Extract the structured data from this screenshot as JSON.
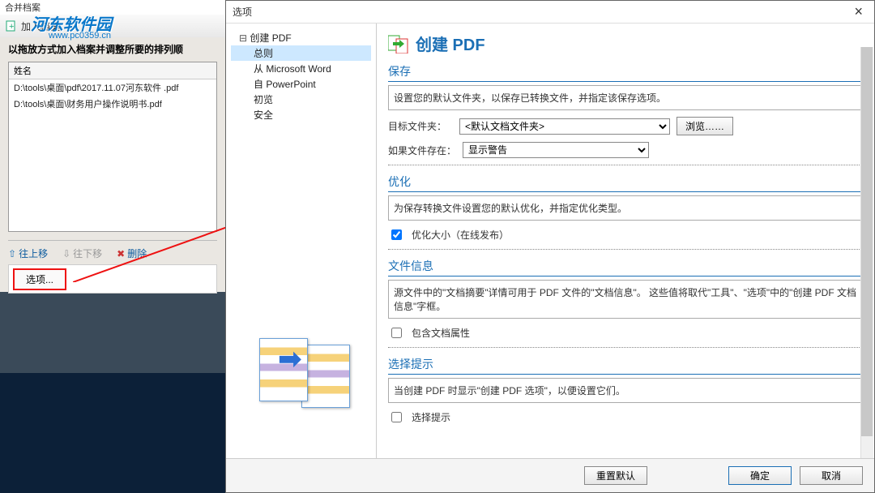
{
  "background": {
    "window_title": "合并档案",
    "toolbar": {
      "add_label": "加入档案"
    },
    "logo_text": "河东软件园",
    "logo_url": "www.pc0359.cn",
    "instruction": "以拖放方式加入档案并调整所要的排列顺",
    "list_header": "姓名",
    "files": [
      "D:\\tools\\桌面\\pdf\\2017.11.07河东软件 .pdf",
      "D:\\tools\\桌面\\财务用户操作说明书.pdf"
    ],
    "actions": {
      "move_up": "往上移",
      "move_down": "往下移",
      "delete": "删除"
    },
    "options_btn": "选项..."
  },
  "dialog": {
    "title": "选项",
    "tree": {
      "root": "创建 PDF",
      "items": [
        "总则",
        "从 Microsoft Word",
        "自 PowerPoint",
        "初览",
        "安全"
      ],
      "selected_index": 0
    },
    "heading": "创建 PDF",
    "sections": {
      "save": {
        "title": "保存",
        "desc": "设置您的默认文件夹，以保存已转换文件，并指定该保存选项。",
        "target_label": "目标文件夹：",
        "target_value": "<默认文档文件夹>",
        "browse": "浏览……",
        "exists_label": "如果文件存在：",
        "exists_value": "显示警告"
      },
      "optimize": {
        "title": "优化",
        "desc": "为保存转换文件设置您的默认优化，并指定优化类型。",
        "chk_optimize": "优化大小（在线发布）"
      },
      "fileinfo": {
        "title": "文件信息",
        "desc": "源文件中的\"文档摘要\"详情可用于 PDF 文件的\"文档信息\"。 这些值将取代\"工具\"、\"选项\"中的\"创建 PDF 文档信息\"字框。",
        "chk_include": "包含文档属性"
      },
      "prompt": {
        "title": "选择提示",
        "desc": "当创建 PDF 时显示\"创建 PDF 选项\"，以便设置它们。",
        "chk_prompt": "选择提示"
      }
    },
    "footer": {
      "reset": "重置默认",
      "ok": "确定",
      "cancel": "取消"
    }
  }
}
